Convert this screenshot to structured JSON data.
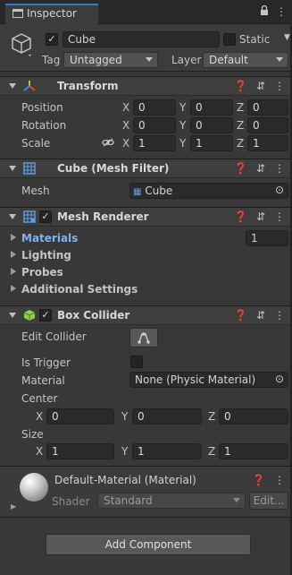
{
  "window": {
    "tab_label": "Inspector"
  },
  "object": {
    "name": "Cube",
    "static_label": "Static",
    "tag_label": "Tag",
    "tag_value": "Untagged",
    "layer_label": "Layer",
    "layer_value": "Default"
  },
  "transform": {
    "title": "Transform",
    "position_label": "Position",
    "rotation_label": "Rotation",
    "scale_label": "Scale",
    "position": {
      "x": "0",
      "y": "0",
      "z": "0"
    },
    "rotation": {
      "x": "0",
      "y": "0",
      "z": "0"
    },
    "scale": {
      "x": "1",
      "y": "1",
      "z": "1"
    }
  },
  "axes": {
    "x": "X",
    "y": "Y",
    "z": "Z"
  },
  "mesh_filter": {
    "title": "Cube (Mesh Filter)",
    "mesh_label": "Mesh",
    "mesh_value": "Cube"
  },
  "mesh_renderer": {
    "title": "Mesh Renderer",
    "materials_label": "Materials",
    "materials_count": "1",
    "lighting_label": "Lighting",
    "probes_label": "Probes",
    "additional_label": "Additional Settings"
  },
  "box_collider": {
    "title": "Box Collider",
    "edit_collider_label": "Edit Collider",
    "is_trigger_label": "Is Trigger",
    "material_label": "Material",
    "material_value": "None (Physic Material)",
    "center_label": "Center",
    "size_label": "Size",
    "center": {
      "x": "0",
      "y": "0",
      "z": "0"
    },
    "size": {
      "x": "1",
      "y": "1",
      "z": "1"
    }
  },
  "material": {
    "name": "Default-Material (Material)",
    "shader_label": "Shader",
    "shader_value": "Standard",
    "edit_label": "Edit..."
  },
  "footer": {
    "add_component_label": "Add Component"
  },
  "colors": {
    "accent_blue": "#3a79bb",
    "link_blue": "#7fb3ee",
    "panel": "#383838",
    "header": "#3e3e3e",
    "collider_green": "#8fd14f"
  }
}
